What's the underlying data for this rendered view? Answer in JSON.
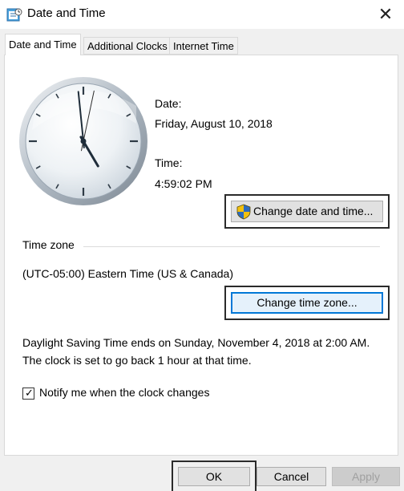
{
  "window": {
    "title": "Date and Time",
    "close_glyph": "✕",
    "icon": "date-time-app-icon"
  },
  "tabs": [
    {
      "label": "Date and Time",
      "active": true
    },
    {
      "label": "Additional Clocks",
      "active": false
    },
    {
      "label": "Internet Time",
      "active": false
    }
  ],
  "clock": {
    "hour": 4,
    "minute": 59,
    "second": 2
  },
  "date": {
    "label": "Date:",
    "value": "Friday, August 10, 2018"
  },
  "time": {
    "label": "Time:",
    "value": "4:59:02 PM"
  },
  "change_datetime_button": {
    "label": "Change date and time...",
    "icon": "uac-shield-icon"
  },
  "time_zone": {
    "heading": "Time zone",
    "value": "(UTC-05:00) Eastern Time (US & Canada)",
    "button_label": "Change time zone..."
  },
  "dst_note": "Daylight Saving Time ends on Sunday, November 4, 2018 at 2:00 AM. The clock is set to go back 1 hour at that time.",
  "notify": {
    "label": "Notify me when the clock changes",
    "checked": true
  },
  "footer": {
    "ok": "OK",
    "cancel": "Cancel",
    "apply": "Apply"
  },
  "colors": {
    "focus_blue": "#0078d7",
    "panel_bg": "#ffffff",
    "dialog_bg": "#f0f0f0"
  }
}
